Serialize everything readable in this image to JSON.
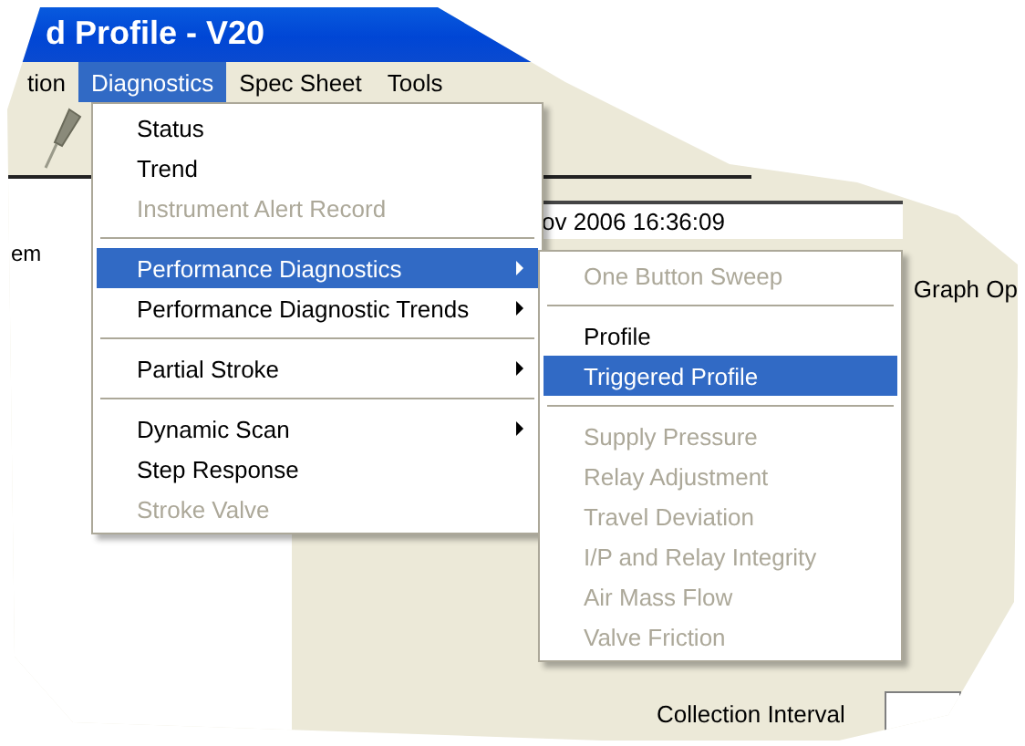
{
  "window": {
    "title": "d Profile - V20"
  },
  "menu_bar": [
    {
      "label": "tion",
      "selected": false
    },
    {
      "label": "Diagnostics",
      "selected": true
    },
    {
      "label": "Spec Sheet",
      "selected": false
    },
    {
      "label": "Tools",
      "selected": false
    }
  ],
  "background": {
    "side_label": "em",
    "timestamp": "ov 2006 16:36:09",
    "graph_label": "Graph Op",
    "collection_label": "Collection Interval"
  },
  "menu": [
    {
      "kind": "item",
      "label": "Status",
      "disabled": false,
      "selected": false,
      "submenu": false
    },
    {
      "kind": "item",
      "label": "Trend",
      "disabled": false,
      "selected": false,
      "submenu": false
    },
    {
      "kind": "item",
      "label": "Instrument Alert Record",
      "disabled": true,
      "selected": false,
      "submenu": false
    },
    {
      "kind": "separator"
    },
    {
      "kind": "item",
      "label": "Performance Diagnostics",
      "disabled": false,
      "selected": true,
      "submenu": true
    },
    {
      "kind": "item",
      "label": "Performance Diagnostic Trends",
      "disabled": false,
      "selected": false,
      "submenu": true
    },
    {
      "kind": "separator"
    },
    {
      "kind": "item",
      "label": "Partial Stroke",
      "disabled": false,
      "selected": false,
      "submenu": true
    },
    {
      "kind": "separator"
    },
    {
      "kind": "item",
      "label": "Dynamic Scan",
      "disabled": false,
      "selected": false,
      "submenu": true
    },
    {
      "kind": "item",
      "label": "Step Response",
      "disabled": false,
      "selected": false,
      "submenu": false
    },
    {
      "kind": "item",
      "label": "Stroke Valve",
      "disabled": true,
      "selected": false,
      "submenu": false
    }
  ],
  "submenu": [
    {
      "kind": "item",
      "label": "One Button Sweep",
      "disabled": true,
      "selected": false,
      "submenu": false
    },
    {
      "kind": "separator"
    },
    {
      "kind": "item",
      "label": "Profile",
      "disabled": false,
      "selected": false,
      "submenu": false
    },
    {
      "kind": "item",
      "label": "Triggered Profile",
      "disabled": false,
      "selected": true,
      "submenu": false
    },
    {
      "kind": "separator"
    },
    {
      "kind": "item",
      "label": "Supply Pressure",
      "disabled": true,
      "selected": false,
      "submenu": false
    },
    {
      "kind": "item",
      "label": "Relay Adjustment",
      "disabled": true,
      "selected": false,
      "submenu": false
    },
    {
      "kind": "item",
      "label": "Travel Deviation",
      "disabled": true,
      "selected": false,
      "submenu": false
    },
    {
      "kind": "item",
      "label": "I/P and Relay Integrity",
      "disabled": true,
      "selected": false,
      "submenu": false
    },
    {
      "kind": "item",
      "label": "Air Mass Flow",
      "disabled": true,
      "selected": false,
      "submenu": false
    },
    {
      "kind": "item",
      "label": "Valve Friction",
      "disabled": true,
      "selected": false,
      "submenu": false
    }
  ]
}
